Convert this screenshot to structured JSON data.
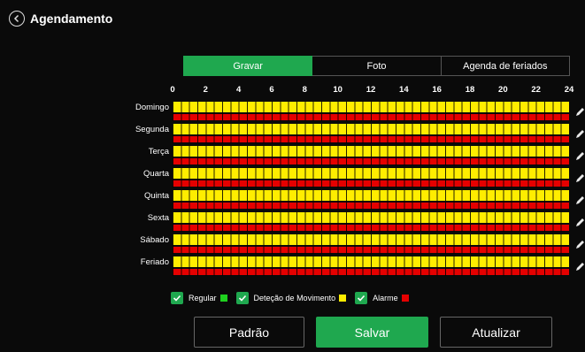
{
  "header": {
    "title": "Agendamento",
    "back_icon": "back-circle-icon"
  },
  "tabs": [
    {
      "label": "Gravar",
      "active": true
    },
    {
      "label": "Foto",
      "active": false
    },
    {
      "label": "Agenda de feriados",
      "active": false
    }
  ],
  "hours": [
    "0",
    "2",
    "4",
    "6",
    "8",
    "10",
    "12",
    "14",
    "16",
    "18",
    "20",
    "22",
    "24"
  ],
  "days": [
    "Domingo",
    "Segunda",
    "Terça",
    "Quarta",
    "Quinta",
    "Sexta",
    "Sábado",
    "Feriado"
  ],
  "legend": [
    {
      "label": "Regular",
      "color": "#1fd11f",
      "checked": true
    },
    {
      "label": "Deteção de Movimento",
      "color": "#ffed00",
      "checked": true
    },
    {
      "label": "Alarme",
      "color": "#e50000",
      "checked": true
    }
  ],
  "buttons": {
    "default": "Padrão",
    "save": "Salvar",
    "refresh": "Atualizar"
  },
  "colors": {
    "accent": "#1fa84f",
    "regular": "#1fd11f",
    "motion": "#ffed00",
    "alarm": "#e50000"
  }
}
